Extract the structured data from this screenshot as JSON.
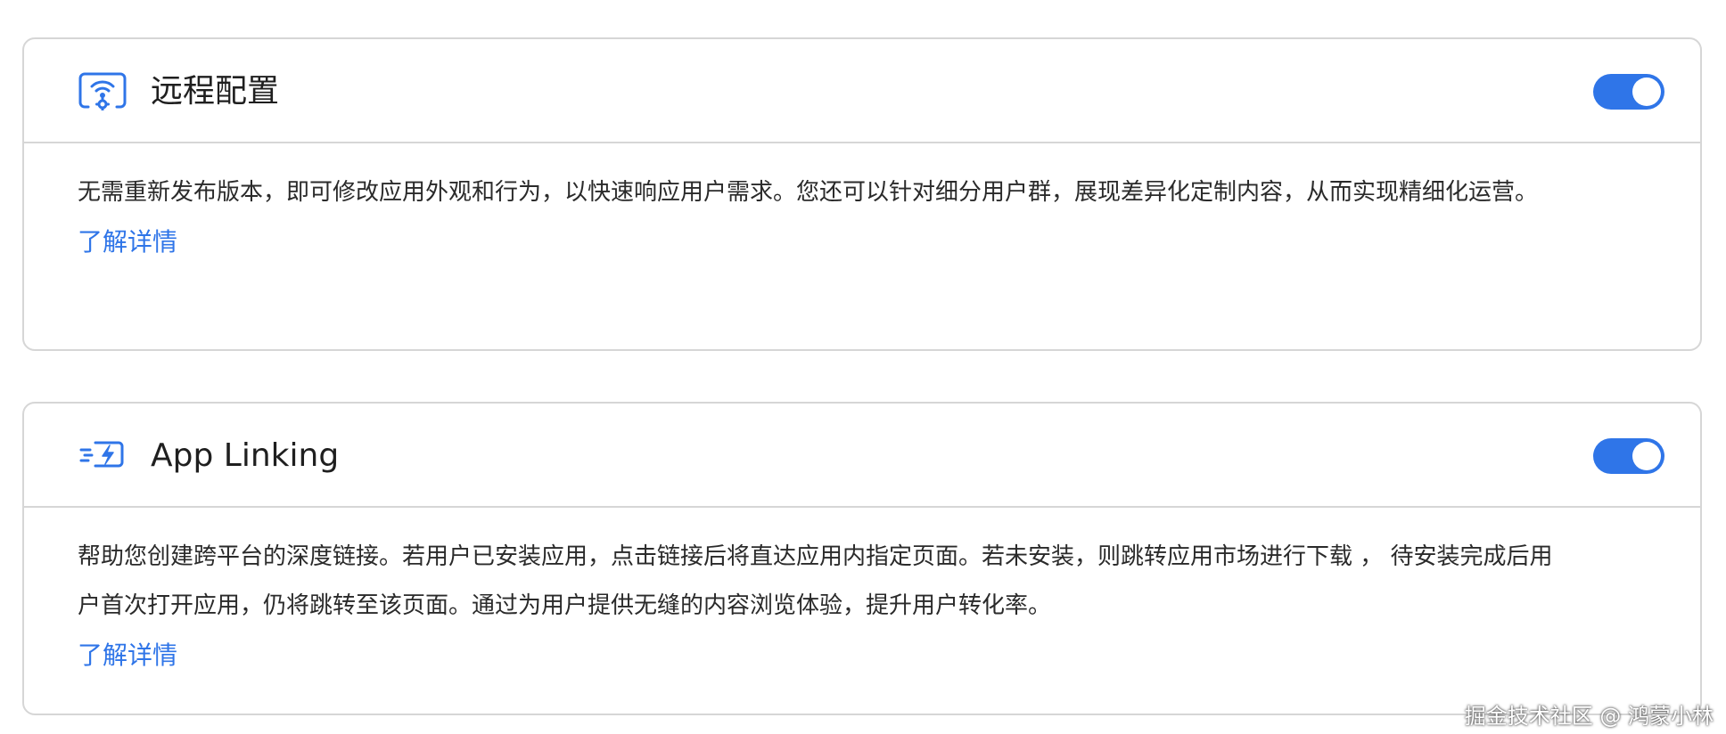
{
  "cards": [
    {
      "title": "远程配置",
      "icon": "remote-config-icon",
      "enabled": true,
      "description": "无需重新发布版本，即可修改应用外观和行为，以快速响应用户需求。您还可以针对细分用户群，展现差异化定制内容，从而实现精细化运营。",
      "link": "了解详情"
    },
    {
      "title": "App Linking",
      "icon": "app-linking-icon",
      "enabled": true,
      "description": "帮助您创建跨平台的深度链接。若用户已安装应用，点击链接后将直达应用内指定页面。若未安装，则跳转应用市场进行下载 ， 待安装完成后用户首次打开应用，仍将跳转至该页面。通过为用户提供无缝的内容浏览体验，提升用户转化率。",
      "link": "了解详情"
    }
  ],
  "watermark": "掘金技术社区 @ 鸿蒙小林",
  "colors": {
    "accent": "#2f75e8",
    "border": "#d6d6d6"
  }
}
